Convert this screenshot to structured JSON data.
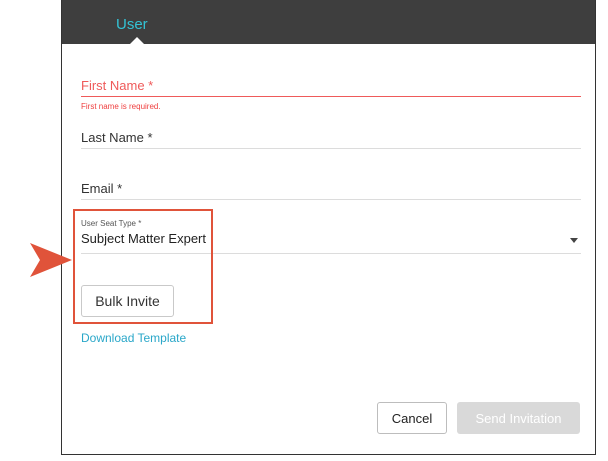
{
  "header": {
    "tab_label": "User"
  },
  "form": {
    "first_name": {
      "label": "First Name *",
      "error": "First name is required."
    },
    "last_name": {
      "label": "Last Name *"
    },
    "email": {
      "label": "Email *"
    },
    "seat_type": {
      "label": "User Seat Type *",
      "value": "Subject Matter Expert"
    }
  },
  "actions": {
    "bulk_invite": "Bulk Invite",
    "download_template": "Download Template",
    "cancel": "Cancel",
    "send_invitation": "Send Invitation"
  },
  "annotation": {
    "color": "#e0533a",
    "arrow_icon": "arrow-right-icon"
  },
  "colors": {
    "accent": "#33c3d5",
    "error": "#ef5a5a",
    "link": "#2aa7c9"
  }
}
